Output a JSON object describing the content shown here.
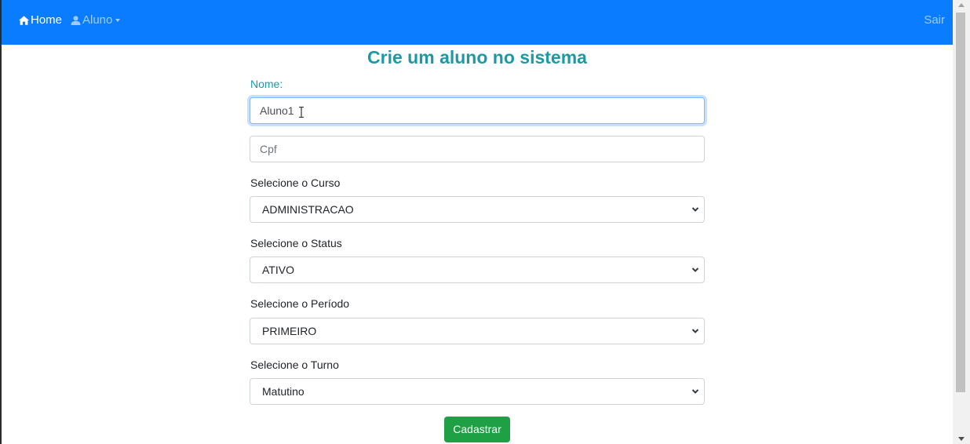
{
  "navbar": {
    "home_label": "Home",
    "aluno_label": "Aluno",
    "sair_label": "Sair"
  },
  "form": {
    "title": "Crie um aluno no sistema",
    "nome_label": "Nome:",
    "nome_value": "Aluno1",
    "cpf_placeholder": "Cpf",
    "curso_label": "Selecione o Curso",
    "curso_value": "ADMINISTRACAO",
    "status_label": "Selecione o Status",
    "status_value": "ATIVO",
    "periodo_label": "Selecione o Período",
    "periodo_value": "PRIMEIRO",
    "turno_label": "Selecione o Turno",
    "turno_value": "Matutino",
    "submit_label": "Cadastrar"
  },
  "colors": {
    "navbar_bg": "#0a7cff",
    "title": "#1a9aa6",
    "submit_bg": "#1fa044"
  }
}
